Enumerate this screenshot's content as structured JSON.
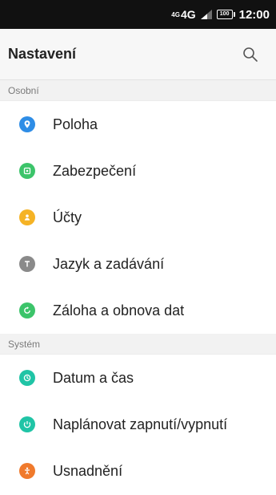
{
  "status_bar": {
    "network_sup": "4G",
    "network": "4G",
    "battery": "100",
    "time": "12:00"
  },
  "toolbar": {
    "title": "Nastavení",
    "search_icon": "search-icon"
  },
  "sections": [
    {
      "header": "Osobní",
      "items": [
        {
          "label": "Poloha",
          "icon": "location-icon",
          "color": "#2e8de6"
        },
        {
          "label": "Zabezpečení",
          "icon": "security-icon",
          "color": "#3cc46a"
        },
        {
          "label": "Účty",
          "icon": "accounts-icon",
          "color": "#f5b325"
        },
        {
          "label": "Jazyk a zadávání",
          "icon": "language-icon",
          "color": "#8a8a8a"
        },
        {
          "label": "Záloha a obnova dat",
          "icon": "backup-icon",
          "color": "#3cc46a"
        }
      ]
    },
    {
      "header": "Systém",
      "items": [
        {
          "label": "Datum a čas",
          "icon": "clock-icon",
          "color": "#20c4a6"
        },
        {
          "label": "Naplánovat zapnutí/vypnutí",
          "icon": "schedule-power-icon",
          "color": "#20c4a6"
        },
        {
          "label": "Usnadnění",
          "icon": "accessibility-icon",
          "color": "#f07a2c"
        }
      ]
    }
  ]
}
